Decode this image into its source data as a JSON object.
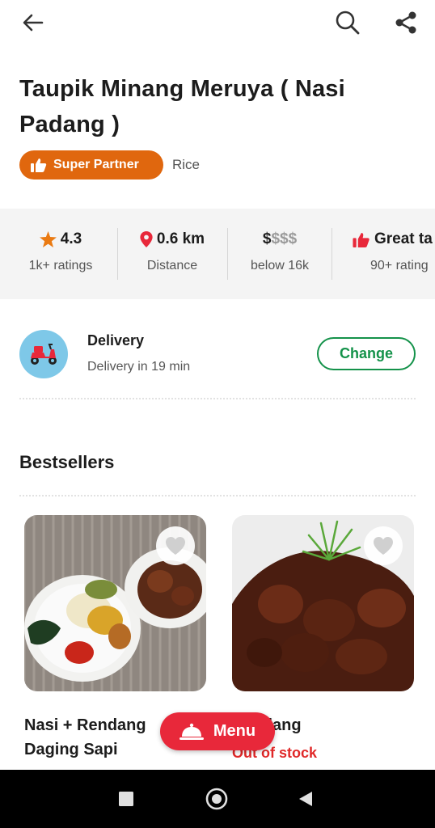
{
  "header": {
    "back_icon": "arrow-left-icon",
    "search_icon": "search-icon",
    "share_icon": "share-icon"
  },
  "restaurant": {
    "name": "Taupik Minang Meruya ( Nasi Padang )",
    "badge": "Super Partner",
    "cuisine": "Rice",
    "accent_color": "#e0670e"
  },
  "stats": [
    {
      "value": "4.3",
      "label": "1k+ ratings",
      "icon": "star-icon"
    },
    {
      "value": "0.6 km",
      "label": "Distance",
      "icon": "location-pin-icon"
    },
    {
      "value_active": "$",
      "value_muted": "$$$",
      "label": "below 16k"
    },
    {
      "value": "Great ta",
      "label": "90+ rating",
      "icon": "thumbs-up-icon"
    }
  ],
  "delivery": {
    "title": "Delivery",
    "subtitle": "Delivery in 19 min",
    "change_label": "Change",
    "button_color": "#14924a"
  },
  "bestsellers": {
    "title": "Bestsellers",
    "items": [
      {
        "name": "Nasi + Rendang Daging Sapi",
        "image": "nasi-padang-plate-photo"
      },
      {
        "name": "Rendang",
        "visible_name": "dang",
        "status": "Out of stock",
        "image": "rendang-beef-photo"
      }
    ]
  },
  "menu_button": {
    "label": "Menu",
    "color": "#e8283a"
  },
  "navbar": {
    "buttons": [
      "recent-apps",
      "home",
      "back"
    ]
  }
}
